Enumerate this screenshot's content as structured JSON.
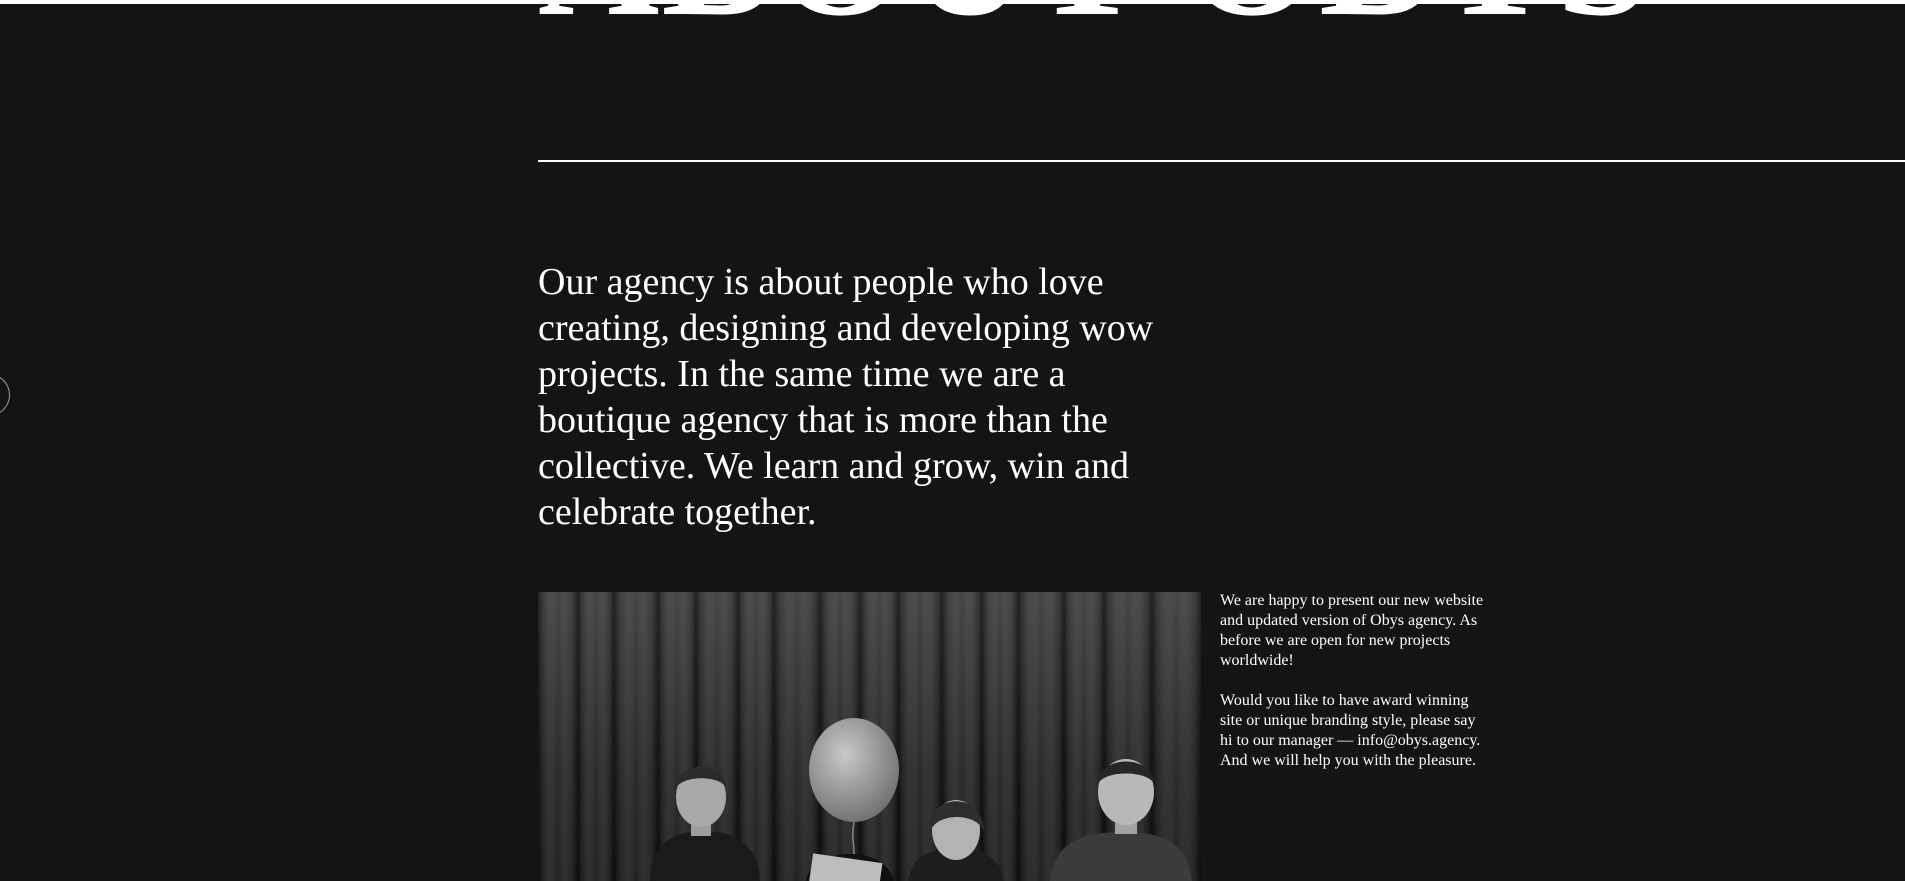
{
  "header": {
    "title": "ABOUT OBYS"
  },
  "intro": {
    "text": "Our agency is about people who love creating, designing and developing wow projects. In the same time we are a boutique agency that is more than the collective. We learn and grow, win and celebrate together."
  },
  "photo": {
    "description_alt": "Obys team photo"
  },
  "side": {
    "paragraph_1": "We are happy to present our new website and updated version of Obys agency. As before we are open for new projects worldwide!",
    "paragraph_2": "Would you like to have award winning site or unique branding style, please say hi to our manager — info@obys.agency. And we will help you with the pleasure."
  }
}
